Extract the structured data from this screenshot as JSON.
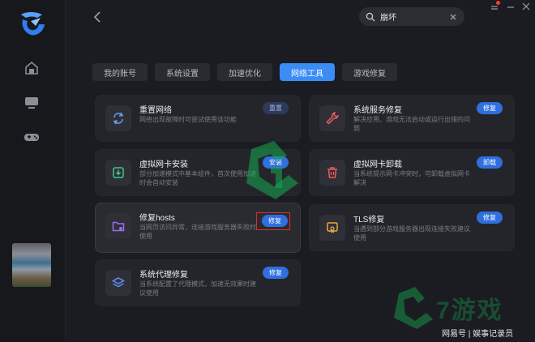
{
  "window": {
    "notify_color": "#ff3b30"
  },
  "search": {
    "query": "崩坏"
  },
  "tabs": [
    {
      "label": "我的账号",
      "active": false
    },
    {
      "label": "系统设置",
      "active": false
    },
    {
      "label": "加速优化",
      "active": false
    },
    {
      "label": "网络工具",
      "active": true
    },
    {
      "label": "游戏修复",
      "active": false
    }
  ],
  "cards": [
    {
      "title": "重置网络",
      "desc": "网络出现故障时可尝试使用该功能",
      "button": "重置",
      "icon": "refresh-icon"
    },
    {
      "title": "系统服务修复",
      "desc": "解决应用、游戏无法启动或运行出错的问题",
      "button": "修复",
      "icon": "wrench-icon"
    },
    {
      "title": "虚拟网卡安装",
      "desc": "部分加速模式中基本组件，首次使用加速时会自动安装",
      "button": "安装",
      "icon": "download-icon"
    },
    {
      "title": "虚拟网卡卸载",
      "desc": "当系统提示网卡冲突时，可卸载虚拟网卡解决",
      "button": "卸载",
      "icon": "trash-icon"
    },
    {
      "title": "修复hosts",
      "desc": "当网页访问异常，连接游戏服务器失败时使用",
      "button": "修复",
      "icon": "folder-icon"
    },
    {
      "title": "TLS修复",
      "desc": "当遇到部分游戏服务器出现连接失败建议使用",
      "button": "修复",
      "icon": "certificate-icon"
    },
    {
      "title": "系统代理修复",
      "desc": "当系统配置了代理模式，加速无效果时建议使用",
      "button": "修复",
      "icon": "layers-icon"
    }
  ],
  "watermark": {
    "text": "网易号 | 娱事记录员",
    "brand": "7游戏"
  },
  "colors": {
    "accent": "#3b8cf5",
    "highlight_box": "#e02b2b"
  }
}
